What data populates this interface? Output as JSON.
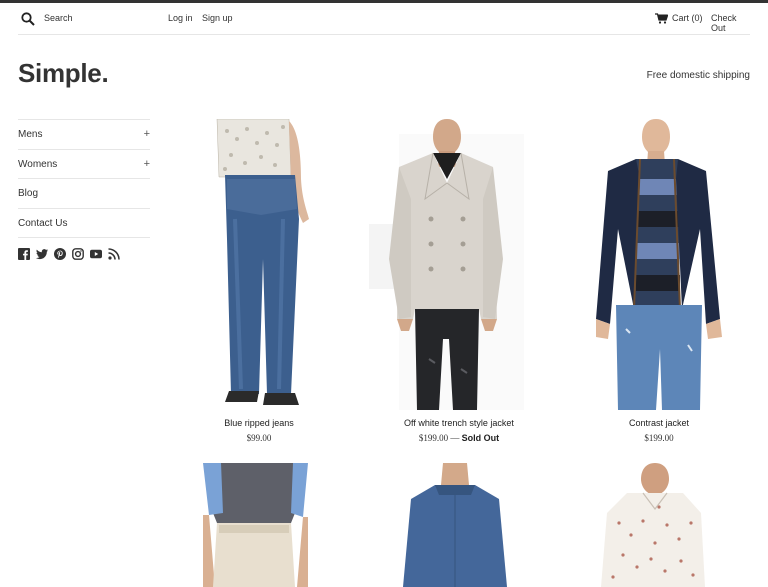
{
  "header": {
    "search_label": "Search",
    "login_label": "Log in",
    "signup_label": "Sign up",
    "cart_label": "Cart (0)",
    "checkout_label": "Check Out"
  },
  "brand": {
    "logo_text": "Simple.",
    "shipping_text": "Free domestic shipping"
  },
  "sidebar": {
    "items": [
      {
        "label": "Mens",
        "expand": "+"
      },
      {
        "label": "Womens",
        "expand": "+"
      },
      {
        "label": "Blog"
      },
      {
        "label": "Contact Us"
      }
    ],
    "social_icons": [
      "facebook-icon",
      "twitter-icon",
      "pinterest-icon",
      "instagram-icon",
      "youtube-icon",
      "rss-icon"
    ]
  },
  "products": [
    {
      "title": "Blue ripped jeans",
      "price": "$99.00",
      "status": ""
    },
    {
      "title": "Off white trench style jacket",
      "price": "$199.00",
      "sep": "—",
      "status": "Sold Out"
    },
    {
      "title": "Contrast jacket",
      "price": "$199.00",
      "status": ""
    }
  ],
  "colors": {
    "topbar": "#333333",
    "text": "#222222",
    "divider": "#e6e6e6"
  }
}
